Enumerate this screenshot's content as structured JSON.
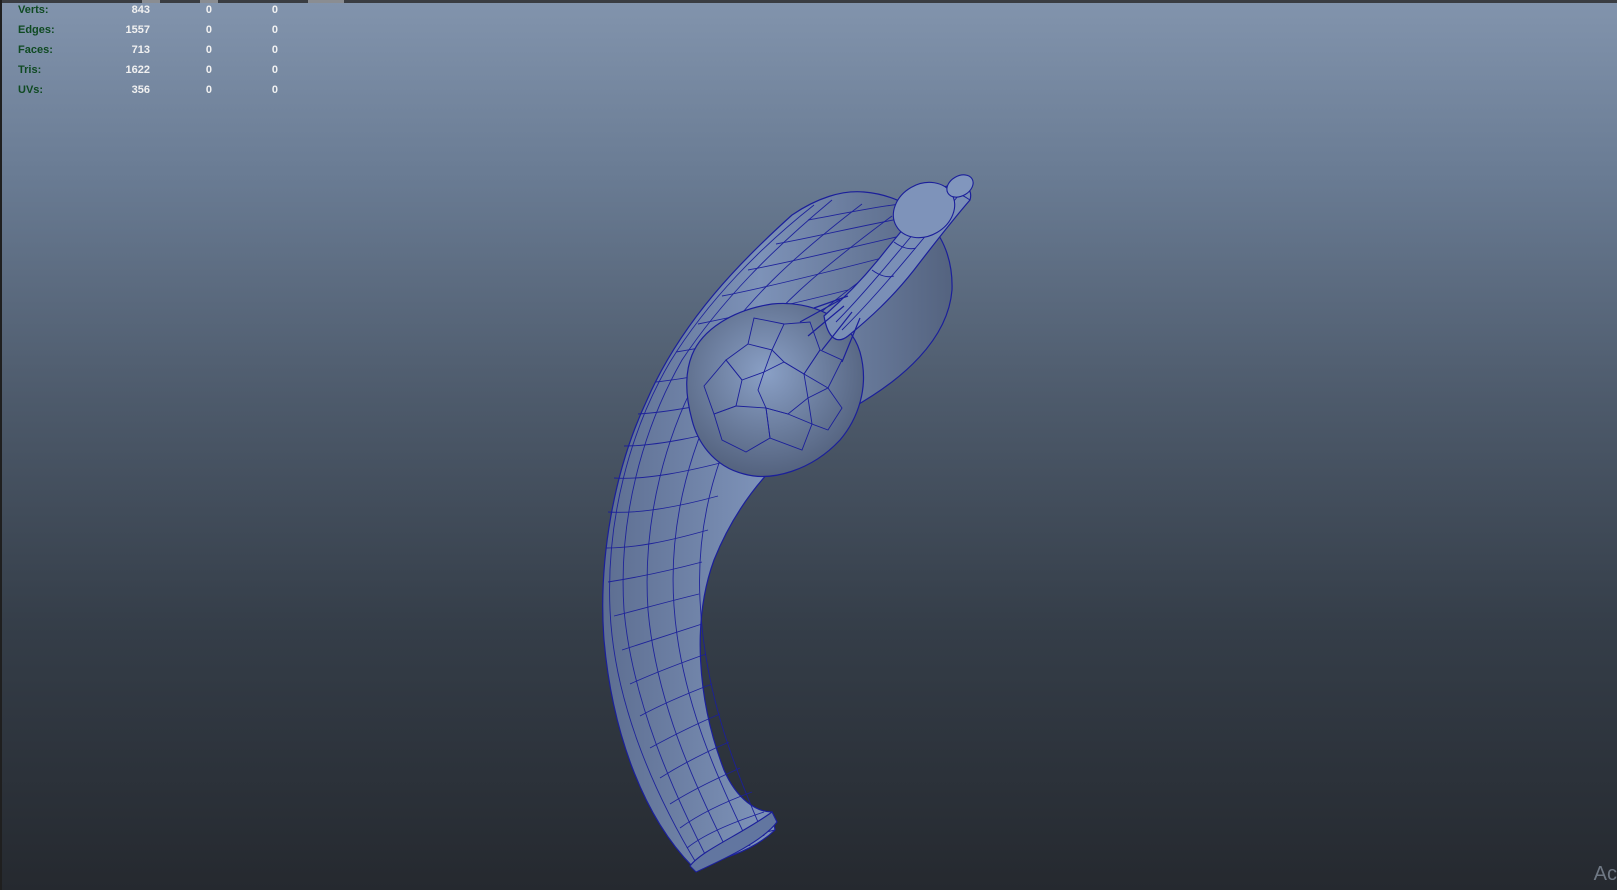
{
  "hud": {
    "rows": [
      {
        "label": "Verts:",
        "total": "843",
        "selected": "0",
        "triangles": "0"
      },
      {
        "label": "Edges:",
        "total": "1557",
        "selected": "0",
        "triangles": "0"
      },
      {
        "label": "Faces:",
        "total": "713",
        "selected": "0",
        "triangles": "0"
      },
      {
        "label": "Tris:",
        "total": "1622",
        "selected": "0",
        "triangles": "0"
      },
      {
        "label": "UVs:",
        "total": "356",
        "selected": "0",
        "triangles": "0"
      }
    ]
  },
  "watermark": "Ac",
  "colors": {
    "hud_label": "#0f4a22",
    "hud_value": "#f1f1f1",
    "mesh_fill": "#7488b0",
    "wire": "#1b1f9a"
  }
}
